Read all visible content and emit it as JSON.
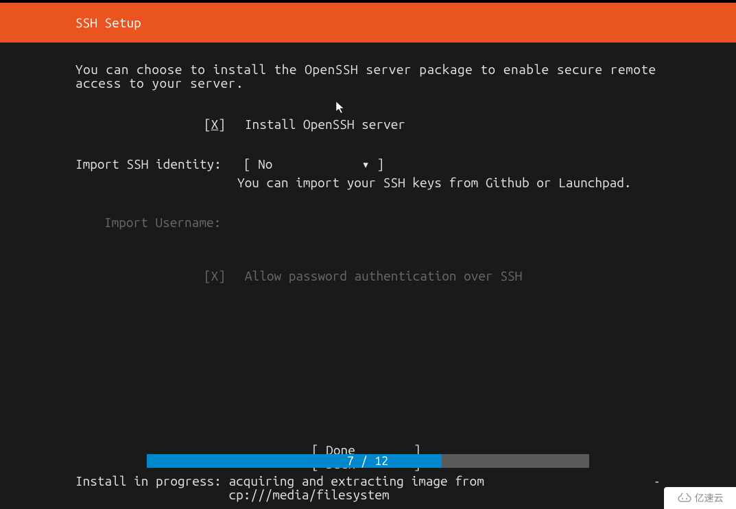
{
  "header": {
    "title": "SSH Setup"
  },
  "description": "You can choose to install the OpenSSH server package to enable secure remote\naccess to your server.",
  "install_option": {
    "checkbox_prefix": "[",
    "checkbox_mark": "X",
    "checkbox_suffix": "]",
    "label": "Install OpenSSH server"
  },
  "import_identity": {
    "label": "Import SSH identity:",
    "dropdown_prefix": "[ ",
    "dropdown_value": "No",
    "dropdown_arrow": "▾",
    "dropdown_suffix": " ]",
    "hint": "You can import your SSH keys from Github or Launchpad."
  },
  "import_username": {
    "label": "Import Username:",
    "value": ""
  },
  "allow_password": {
    "checkbox": "[X]",
    "label": "Allow password authentication over SSH"
  },
  "nav": {
    "done": "[ Done        ]",
    "back": "[ Back        ]"
  },
  "progress": {
    "text": "7 / 12",
    "current": 7,
    "total": 12
  },
  "status": {
    "line1": "Install in progress: acquiring and extracting image from",
    "line2": "                     cp:///media/filesystem",
    "spinner": "-"
  },
  "watermark": {
    "text": "亿速云"
  }
}
